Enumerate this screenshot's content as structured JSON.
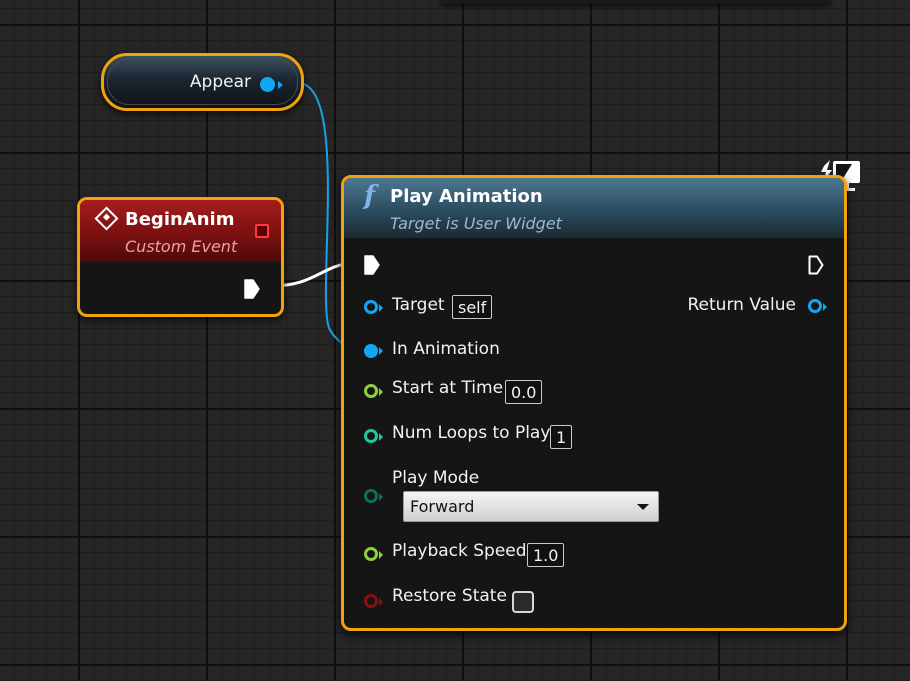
{
  "variable_node": {
    "label": "Appear",
    "pin_color": "#12a6f5"
  },
  "event_node": {
    "title": "BeginAnim",
    "subtitle": "Custom Event",
    "header_color": "#a51d1d",
    "delegate_pin_color": "#ff3a3a"
  },
  "function_node": {
    "icon": "f",
    "title": "Play Animation",
    "subtitle": "Target is User Widget",
    "header_color": "#2b4b5e",
    "target": {
      "label": "Target",
      "value": "self"
    },
    "return_value": {
      "label": "Return Value"
    },
    "in_animation": {
      "label": "In Animation"
    },
    "start_at_time": {
      "label": "Start at Time",
      "value": "0.0"
    },
    "num_loops": {
      "label": "Num Loops to Play",
      "value": "1"
    },
    "play_mode": {
      "label": "Play Mode",
      "selected": "Forward"
    },
    "playback_speed": {
      "label": "Playback Speed",
      "value": "1.0"
    },
    "restore_state": {
      "label": "Restore State",
      "checked": false
    }
  },
  "colors": {
    "selection_outline": "#f0a30a",
    "object_pin": "#12a6f5",
    "float_pin": "#8fd13a",
    "int_pin": "#1fc8a0",
    "byte_pin": "#0f6b5a",
    "bool_pin": "#8a0f0f",
    "exec_pin": "#ffffff"
  },
  "icons": {
    "function": "function-icon",
    "event": "custom-event-icon",
    "widget": "widget-blueprint-icon"
  }
}
